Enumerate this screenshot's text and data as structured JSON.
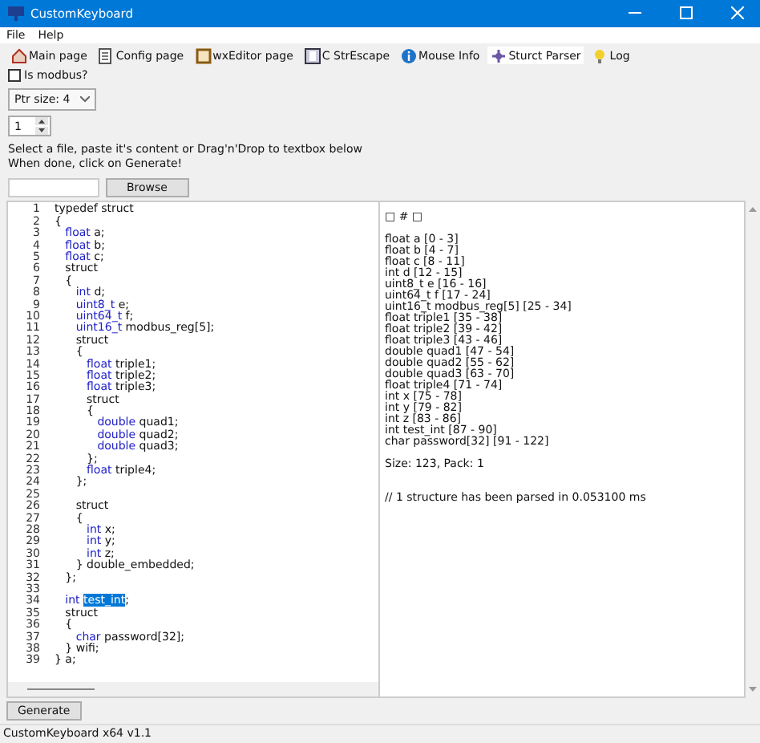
{
  "window": {
    "title": "CustomKeyboard"
  },
  "menu": [
    "File",
    "Help"
  ],
  "tabs": [
    {
      "label": "Main page",
      "selected": false
    },
    {
      "label": "Config page",
      "selected": false
    },
    {
      "label": "wxEditor page",
      "selected": false
    },
    {
      "label": "C StrEscape",
      "selected": false
    },
    {
      "label": "Mouse Info",
      "selected": false
    },
    {
      "label": "Sturct Parser",
      "selected": true
    },
    {
      "label": "Log",
      "selected": false
    }
  ],
  "modbus": {
    "label": "Is modbus?",
    "checked": false
  },
  "ptr_size": {
    "value": "Ptr size: 4"
  },
  "pack": {
    "value": "1"
  },
  "instructions": [
    "Select a file, paste it's content or Drag'n'Drop to textbox below",
    "When done, click on Generate!"
  ],
  "browse_button": "Browse",
  "editor_lines": [
    {
      "number": "1",
      "parts": [
        {
          "kind": "plain",
          "text": "typedef struct"
        }
      ]
    },
    {
      "number": "2",
      "parts": [
        {
          "kind": "plain",
          "text": "{"
        }
      ]
    },
    {
      "number": "3",
      "parts": [
        {
          "kind": "keyword",
          "text": "   float"
        },
        {
          "kind": "plain",
          "text": " a;"
        }
      ]
    },
    {
      "number": "4",
      "parts": [
        {
          "kind": "keyword",
          "text": "   float"
        },
        {
          "kind": "plain",
          "text": " b;"
        }
      ]
    },
    {
      "number": "5",
      "parts": [
        {
          "kind": "keyword",
          "text": "   float"
        },
        {
          "kind": "plain",
          "text": " c;"
        }
      ]
    },
    {
      "number": "6",
      "parts": [
        {
          "kind": "plain",
          "text": "   struct"
        }
      ]
    },
    {
      "number": "7",
      "parts": [
        {
          "kind": "plain",
          "text": "   {"
        }
      ]
    },
    {
      "number": "8",
      "parts": [
        {
          "kind": "keyword",
          "text": "      int"
        },
        {
          "kind": "plain",
          "text": " d;"
        }
      ]
    },
    {
      "number": "9",
      "parts": [
        {
          "kind": "keyword",
          "text": "      uint8_t"
        },
        {
          "kind": "plain",
          "text": " e;"
        }
      ]
    },
    {
      "number": "10",
      "parts": [
        {
          "kind": "keyword",
          "text": "      uint64_t"
        },
        {
          "kind": "plain",
          "text": " f;"
        }
      ]
    },
    {
      "number": "11",
      "parts": [
        {
          "kind": "keyword",
          "text": "      uint16_t"
        },
        {
          "kind": "plain",
          "text": " modbus_reg[5];"
        }
      ]
    },
    {
      "number": "12",
      "parts": [
        {
          "kind": "plain",
          "text": "      struct"
        }
      ]
    },
    {
      "number": "13",
      "parts": [
        {
          "kind": "plain",
          "text": "      {"
        }
      ]
    },
    {
      "number": "14",
      "parts": [
        {
          "kind": "keyword",
          "text": "         float"
        },
        {
          "kind": "plain",
          "text": " triple1;"
        }
      ]
    },
    {
      "number": "15",
      "parts": [
        {
          "kind": "keyword",
          "text": "         float"
        },
        {
          "kind": "plain",
          "text": " triple2;"
        }
      ]
    },
    {
      "number": "16",
      "parts": [
        {
          "kind": "keyword",
          "text": "         float"
        },
        {
          "kind": "plain",
          "text": " triple3;"
        }
      ]
    },
    {
      "number": "17",
      "parts": [
        {
          "kind": "plain",
          "text": "         struct"
        }
      ]
    },
    {
      "number": "18",
      "parts": [
        {
          "kind": "plain",
          "text": "         {"
        }
      ]
    },
    {
      "number": "19",
      "parts": [
        {
          "kind": "keyword",
          "text": "            double"
        },
        {
          "kind": "plain",
          "text": " quad1;"
        }
      ]
    },
    {
      "number": "20",
      "parts": [
        {
          "kind": "keyword",
          "text": "            double"
        },
        {
          "kind": "plain",
          "text": " quad2;"
        }
      ]
    },
    {
      "number": "21",
      "parts": [
        {
          "kind": "keyword",
          "text": "            double"
        },
        {
          "kind": "plain",
          "text": " quad3;"
        }
      ]
    },
    {
      "number": "22",
      "parts": [
        {
          "kind": "plain",
          "text": "         };"
        }
      ]
    },
    {
      "number": "23",
      "parts": [
        {
          "kind": "keyword",
          "text": "         float"
        },
        {
          "kind": "plain",
          "text": " triple4;"
        }
      ]
    },
    {
      "number": "24",
      "parts": [
        {
          "kind": "plain",
          "text": "      };"
        }
      ]
    },
    {
      "number": "25"
    },
    {
      "number": "26",
      "parts": [
        {
          "kind": "plain",
          "text": "      struct"
        }
      ]
    },
    {
      "number": "27",
      "parts": [
        {
          "kind": "plain",
          "text": "      {"
        }
      ]
    },
    {
      "number": "28",
      "parts": [
        {
          "kind": "keyword",
          "text": "         int"
        },
        {
          "kind": "plain",
          "text": " x;"
        }
      ]
    },
    {
      "number": "29",
      "parts": [
        {
          "kind": "keyword",
          "text": "         int"
        },
        {
          "kind": "plain",
          "text": " y;"
        }
      ]
    },
    {
      "number": "30",
      "parts": [
        {
          "kind": "keyword",
          "text": "         int"
        },
        {
          "kind": "plain",
          "text": " z;"
        }
      ]
    },
    {
      "number": "31",
      "parts": [
        {
          "kind": "plain",
          "text": "      } double_embedded;"
        }
      ]
    },
    {
      "number": "32",
      "parts": [
        {
          "kind": "plain",
          "text": "   };"
        }
      ]
    },
    {
      "number": "33"
    },
    {
      "number": "34",
      "parts": [
        {
          "kind": "keyword",
          "text": "   int "
        },
        {
          "kind": "selected",
          "text": "test_int"
        },
        {
          "kind": "plain",
          "text": ";"
        }
      ]
    },
    {
      "number": "35",
      "parts": [
        {
          "kind": "plain",
          "text": "   struct"
        }
      ]
    },
    {
      "number": "36",
      "parts": [
        {
          "kind": "plain",
          "text": "   {"
        }
      ]
    },
    {
      "number": "37",
      "parts": [
        {
          "kind": "keyword",
          "text": "      char"
        },
        {
          "kind": "plain",
          "text": " password[32];"
        }
      ]
    },
    {
      "number": "38",
      "parts": [
        {
          "kind": "plain",
          "text": "   } wifi;"
        }
      ]
    },
    {
      "number": "39",
      "parts": [
        {
          "kind": "plain",
          "text": "} a;"
        }
      ]
    }
  ],
  "output_blocks": [
    [
      "□ # □"
    ],
    [
      "float a [0 - 3]",
      "float b [4 - 7]",
      "float c [8 - 11]",
      "int d [12 - 15]",
      "uint8_t e [16 - 16]",
      "uint64_t f [17 - 24]",
      "uint16_t modbus_reg[5] [25 - 34]",
      "float triple1 [35 - 38]",
      "float triple2 [39 - 42]",
      "float triple3 [43 - 46]",
      "double quad1 [47 - 54]",
      "double quad2 [55 - 62]",
      "double quad3 [63 - 70]",
      "float triple4 [71 - 74]",
      "int x [75 - 78]",
      "int y [79 - 82]",
      "int z [83 - 86]",
      "int test_int [87 - 90]",
      "char password[32] [91 - 122]"
    ],
    [
      "Size: 123, Pack: 1"
    ],
    [
      "// 1 structure has been parsed in 0.053100 ms"
    ]
  ],
  "generate_button": "Generate",
  "status_bar": "CustomKeyboard x64 v1.1"
}
